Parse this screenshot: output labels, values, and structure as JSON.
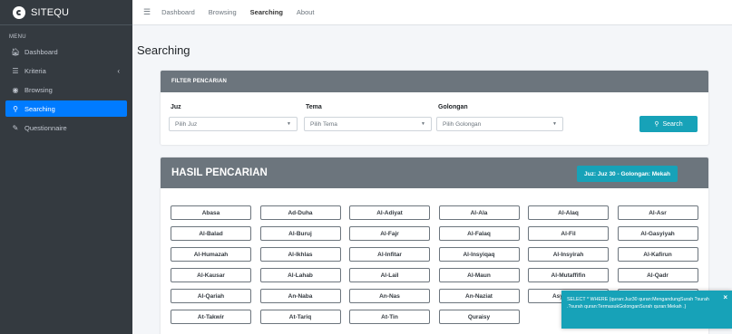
{
  "brand": {
    "name": "SITEQU"
  },
  "sidebar": {
    "menu_header": "MENU",
    "items": [
      {
        "label": "Dashboard",
        "icon": "home-icon"
      },
      {
        "label": "Kriteria",
        "icon": "list-icon"
      },
      {
        "label": "Browsing",
        "icon": "globe-icon"
      },
      {
        "label": "Searching",
        "icon": "search-icon",
        "active": true
      },
      {
        "label": "Questionnaire",
        "icon": "pen-icon"
      }
    ]
  },
  "topbar": {
    "links": [
      "Dashboard",
      "Browsing",
      "Searching",
      "About"
    ],
    "active": "Searching"
  },
  "page": {
    "title": "Searching"
  },
  "filter": {
    "header": "FILTER PENCARIAN",
    "juz": {
      "label": "Juz",
      "placeholder": "Pilih Juz"
    },
    "tema": {
      "label": "Tema",
      "placeholder": "Pilih Tema"
    },
    "golongan": {
      "label": "Golongan",
      "placeholder": "Pilih Golongan"
    },
    "search_label": "Search"
  },
  "result": {
    "header": "HASIL PENCARIAN",
    "badge": "Juz: Juz 30 - Golongan: Mekah",
    "surahs": [
      "Abasa",
      "Ad-Duha",
      "Al-Adiyat",
      "Al-Ala",
      "Al-Alaq",
      "Al-Asr",
      "Al-Balad",
      "Al-Buruj",
      "Al-Fajr",
      "Al-Falaq",
      "Al-Fil",
      "Al-Gasyiyah",
      "Al-Humazah",
      "Al-Ikhlas",
      "Al-Infitar",
      "Al-Insyiqaq",
      "Al-Insyirah",
      "Al-Kafirun",
      "Al-Kausar",
      "Al-Lahab",
      "Al-Lail",
      "Al-Maun",
      "Al-Mutaffifin",
      "Al-Qadr",
      "Al-Qariah",
      "An-Naba",
      "An-Nas",
      "An-Naziat",
      "Asy-Syams",
      "At-Takasur",
      "At-Takwir",
      "At-Tariq",
      "At-Tin",
      "Quraisy"
    ]
  },
  "toast": {
    "text": "SELECT * WHERE {quran:Juz30 quran:MengandungSurah ?surah .?surah quran:TermasukGolonganSurah quran:Mekah .}",
    "close": "×"
  },
  "colors": {
    "accent": "#17a2b8",
    "primary": "#007bff",
    "sidebar": "#343a40",
    "header": "#6c757d"
  }
}
